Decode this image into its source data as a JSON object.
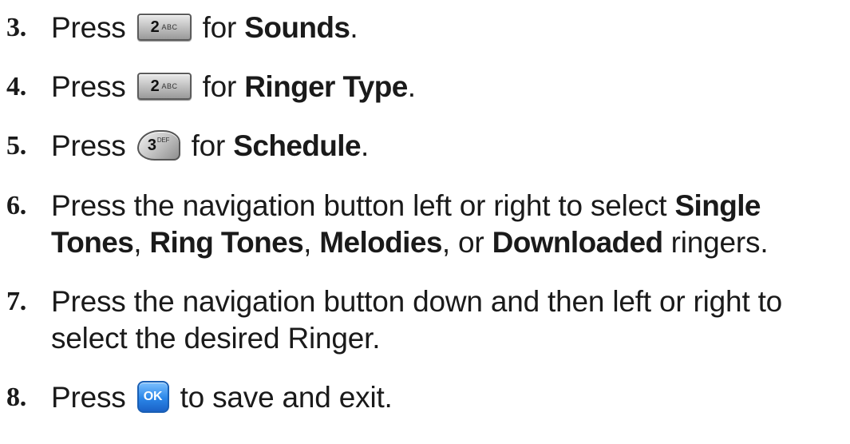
{
  "steps": [
    {
      "number": "3.",
      "pre": "Press",
      "key": {
        "label": "2",
        "sub": "ABC",
        "icon": "key-2-abc-icon"
      },
      "mid": "for",
      "bold": "Sounds",
      "post": "."
    },
    {
      "number": "4.",
      "pre": "Press",
      "key": {
        "label": "2",
        "sub": "ABC",
        "icon": "key-2-abc-icon"
      },
      "mid": "for",
      "bold": "Ringer Type",
      "post": "."
    },
    {
      "number": "5.",
      "pre": "Press",
      "key": {
        "label": "3",
        "sub": "DEF",
        "icon": "key-3-def-icon"
      },
      "mid": "for",
      "bold": "Schedule",
      "post": "."
    },
    {
      "number": "6.",
      "line1_text": "Press the navigation button left or right to select",
      "line1_bold": "Single",
      "line2_bold1": "Tones",
      "line2_sep1": ",",
      "line2_bold2": "Ring Tones",
      "line2_sep2": ",",
      "line2_bold3": "Melodies",
      "line2_sep3": ", or",
      "line2_bold4": "Downloaded",
      "line2_end": "ringers."
    },
    {
      "number": "7.",
      "line1": "Press the navigation button down and then left or right to",
      "line2": "select the desired Ringer."
    },
    {
      "number": "8.",
      "pre": "Press",
      "key": {
        "label": "OK",
        "icon": "ok-key-icon"
      },
      "post": "to save and exit."
    }
  ],
  "colors": {
    "text": "#1a1a1a",
    "ok_key": "#2b86e8",
    "gray_key": "#bdbdbd"
  }
}
